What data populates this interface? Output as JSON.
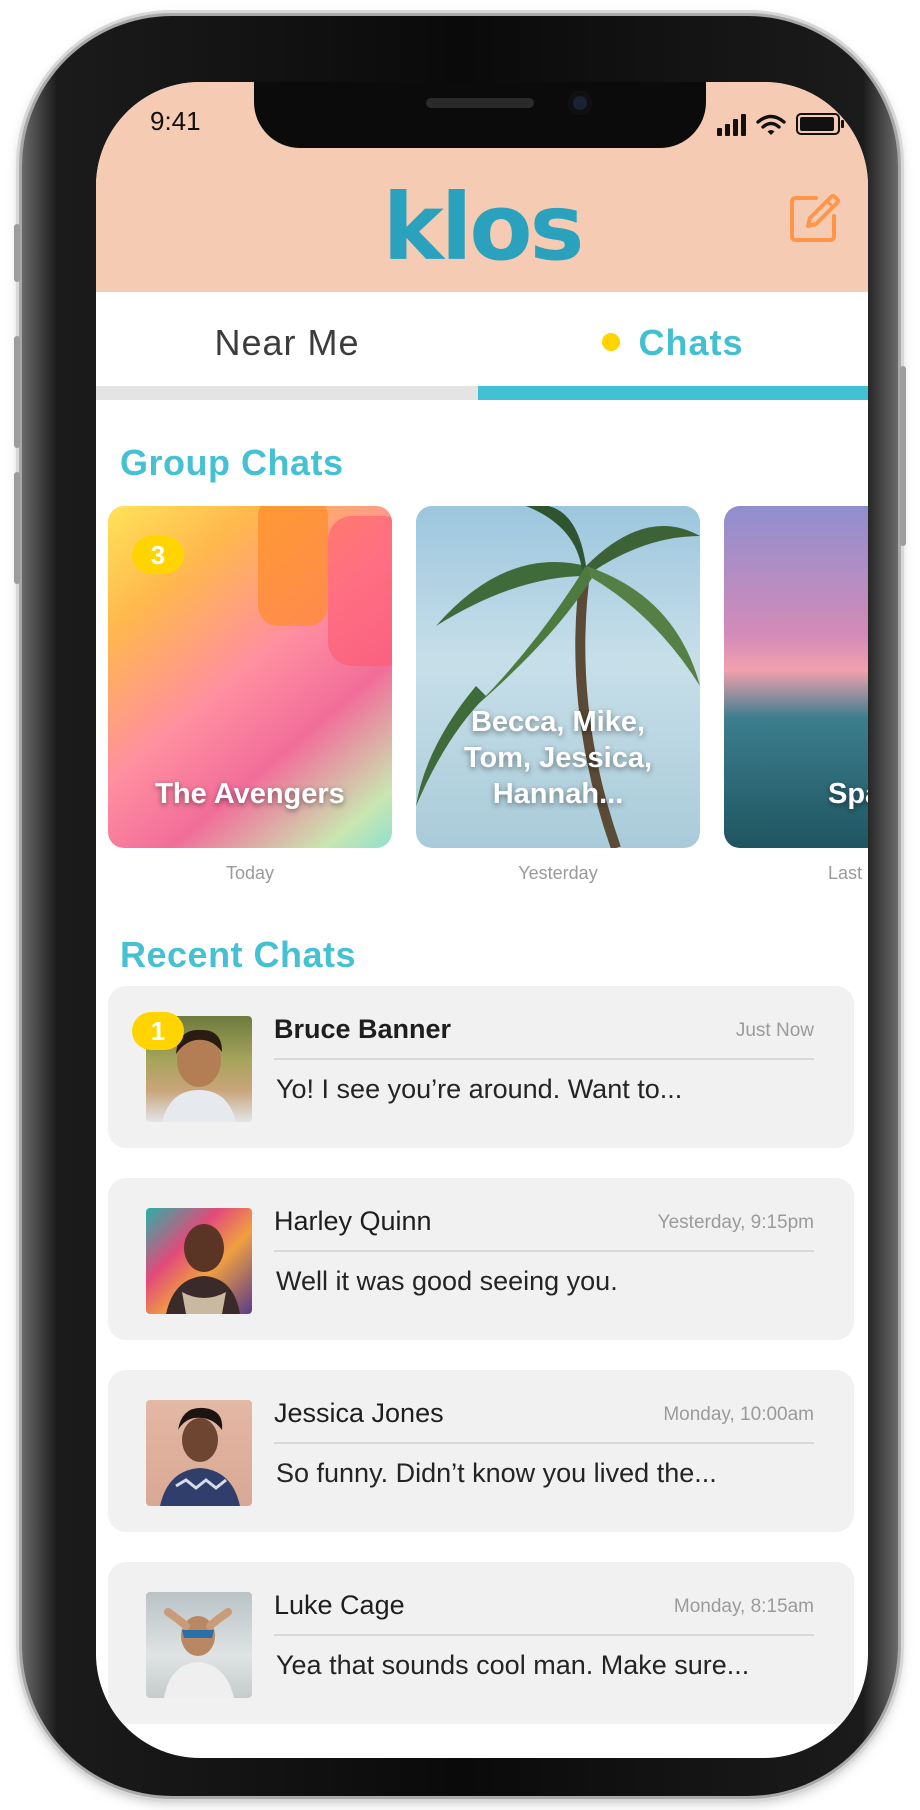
{
  "status_bar": {
    "time": "9:41"
  },
  "app": {
    "logo": "klos",
    "compose_icon": "compose-icon"
  },
  "tabs": [
    {
      "label": "Near Me",
      "active": false
    },
    {
      "label": "Chats",
      "active": true
    }
  ],
  "colors": {
    "header": "#f6cbb3",
    "accent": "#45c1d3",
    "badge": "#ffd400",
    "logo": "#2aa2bd",
    "compose": "#ff9548"
  },
  "group_chats": {
    "title": "Group Chats",
    "items": [
      {
        "name": "The Avengers",
        "date": "Today",
        "badge": "3"
      },
      {
        "name": "Becca, Mike, Tom, Jessica, Hannah...",
        "date": "Yesterday"
      },
      {
        "name": "Spa",
        "date": "Last"
      }
    ]
  },
  "recent_chats": {
    "title": "Recent Chats",
    "items": [
      {
        "name": "Bruce Banner",
        "time": "Just Now",
        "message": "Yo! I see you’re around. Want to...",
        "badge": "1",
        "unread": true
      },
      {
        "name": "Harley Quinn",
        "time": "Yesterday, 9:15pm",
        "message": "Well it was good seeing you."
      },
      {
        "name": "Jessica Jones",
        "time": "Monday, 10:00am",
        "message": "So funny. Didn’t know you lived the..."
      },
      {
        "name": "Luke Cage",
        "time": "Monday, 8:15am",
        "message": "Yea that sounds cool man. Make sure..."
      }
    ]
  }
}
